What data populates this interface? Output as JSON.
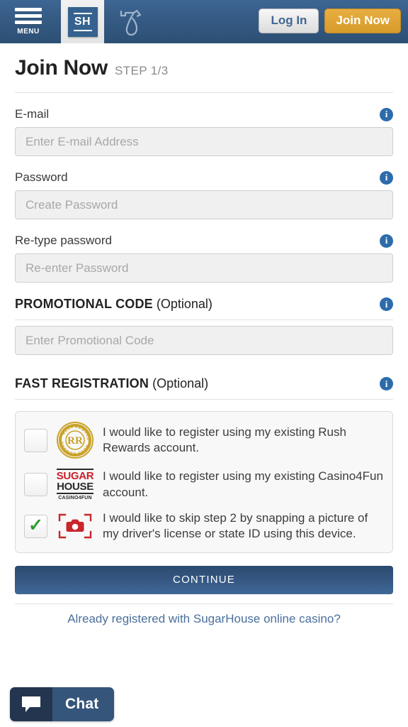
{
  "header": {
    "menu_label": "MENU",
    "brand_logo_text": "SH",
    "seven_icon_name": "lucky-seven-icon",
    "login_label": "Log In",
    "join_label": "Join Now"
  },
  "page": {
    "title": "Join Now",
    "step": "STEP 1/3"
  },
  "fields": {
    "email": {
      "label": "E-mail",
      "placeholder": "Enter E-mail Address",
      "value": ""
    },
    "password": {
      "label": "Password",
      "placeholder": "Create Password",
      "value": ""
    },
    "retype_password": {
      "label": "Re-type password",
      "placeholder": "Re-enter Password",
      "value": ""
    },
    "promo": {
      "label": "PROMOTIONAL CODE",
      "optional": "(Optional)",
      "placeholder": "Enter Promotional Code",
      "value": ""
    }
  },
  "fast_registration": {
    "label": "FAST REGISTRATION",
    "optional": "(Optional)",
    "options": [
      {
        "logo": "rush-rewards-seal",
        "logo_text": "RR",
        "logo_ring_text": "RUSH REWARDS",
        "text": "I would like to register using my existing Rush Rewards account.",
        "checked": false
      },
      {
        "logo": "sugarhouse-casino4fun-logo",
        "logo_line1": "SUGAR",
        "logo_line2": "HOUSE",
        "logo_line3": "CASINO4FUN",
        "text": "I would like to register using my existing Casino4Fun account.",
        "checked": false
      },
      {
        "logo": "camera-scan-icon",
        "text": "I would like to skip step 2 by snapping a picture of my driver's license or state ID using this device.",
        "checked": true
      }
    ]
  },
  "actions": {
    "continue_label": "CONTINUE",
    "already_registered_note": "Already registered with SugarHouse online casino?"
  },
  "chat": {
    "label": "Chat",
    "icon": "speech-bubble-icon"
  },
  "colors": {
    "header_blue": "#35587f",
    "accent_gold": "#dfa436",
    "info_blue": "#2d6cab",
    "check_green": "#2e9b2e",
    "camera_red": "#c9262b",
    "link_blue": "#4a6f9c"
  }
}
